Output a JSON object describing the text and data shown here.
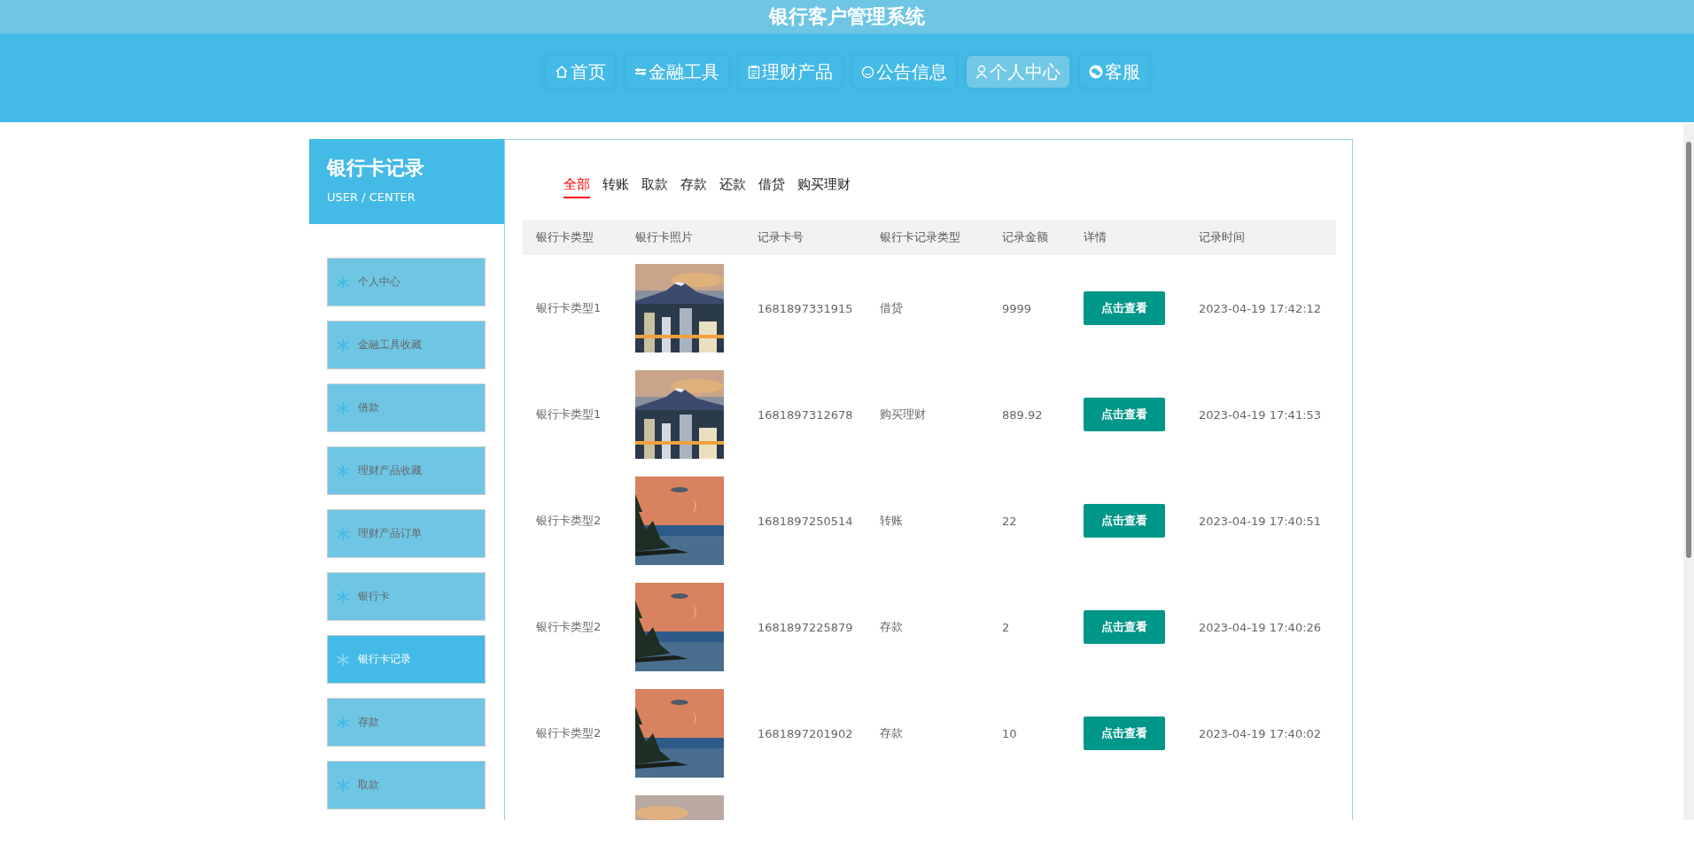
{
  "app_title": "银行客户管理系统",
  "nav": [
    {
      "label": "首页",
      "selected": false
    },
    {
      "label": "金融工具",
      "selected": false
    },
    {
      "label": "理财产品",
      "selected": false
    },
    {
      "label": "公告信息",
      "selected": false
    },
    {
      "label": "个人中心",
      "selected": true
    },
    {
      "label": "客服",
      "selected": false
    }
  ],
  "sidebar": {
    "title": "银行卡记录",
    "subtitle": "USER / CENTER",
    "items": [
      {
        "label": "个人中心",
        "selected": false
      },
      {
        "label": "金融工具收藏",
        "selected": false
      },
      {
        "label": "借款",
        "selected": false
      },
      {
        "label": "理财产品收藏",
        "selected": false
      },
      {
        "label": "理财产品订单",
        "selected": false
      },
      {
        "label": "银行卡",
        "selected": false
      },
      {
        "label": "银行卡记录",
        "selected": true
      },
      {
        "label": "存款",
        "selected": false
      },
      {
        "label": "取款",
        "selected": false
      }
    ]
  },
  "filter_tabs": [
    {
      "label": "全部",
      "selected": true
    },
    {
      "label": "转账",
      "selected": false
    },
    {
      "label": "取款",
      "selected": false
    },
    {
      "label": "存款",
      "selected": false
    },
    {
      "label": "还款",
      "selected": false
    },
    {
      "label": "借贷",
      "selected": false
    },
    {
      "label": "购买理财",
      "selected": false
    }
  ],
  "table": {
    "columns": [
      "银行卡类型",
      "银行卡照片",
      "记录卡号",
      "银行卡记录类型",
      "记录金额",
      "详情",
      "记录时间"
    ],
    "rows": [
      {
        "card_type": "银行卡类型1",
        "photo": {
          "kind": "picture"
        },
        "card_no": "1681897331915",
        "record_type": "借贷",
        "amount": "9999",
        "detail": "点击查看",
        "time": "2023-04-19 17:42:12"
      },
      {
        "card_type": "银行卡类型1",
        "photo": {
          "kind": "picture"
        },
        "card_no": "1681897312678",
        "record_type": "购买理财",
        "amount": "889.92",
        "detail": "点击查看",
        "time": "2023-04-19 17:41:53"
      },
      {
        "card_type": "银行卡类型2",
        "photo": {
          "kind": "picture"
        },
        "card_no": "1681897250514",
        "record_type": "转账",
        "amount": "22",
        "detail": "点击查看",
        "time": "2023-04-19 17:40:51"
      },
      {
        "card_type": "银行卡类型2",
        "photo": {
          "kind": "picture"
        },
        "card_no": "1681897225879",
        "record_type": "存款",
        "amount": "2",
        "detail": "点击查看",
        "time": "2023-04-19 17:40:26"
      },
      {
        "card_type": "银行卡类型2",
        "photo": {
          "kind": "picture"
        },
        "card_no": "1681897201902",
        "record_type": "存款",
        "amount": "10",
        "detail": "点击查看",
        "time": "2023-04-19 17:40:02"
      },
      {
        "photo": {
          "kind": "picture"
        }
      }
    ]
  }
}
